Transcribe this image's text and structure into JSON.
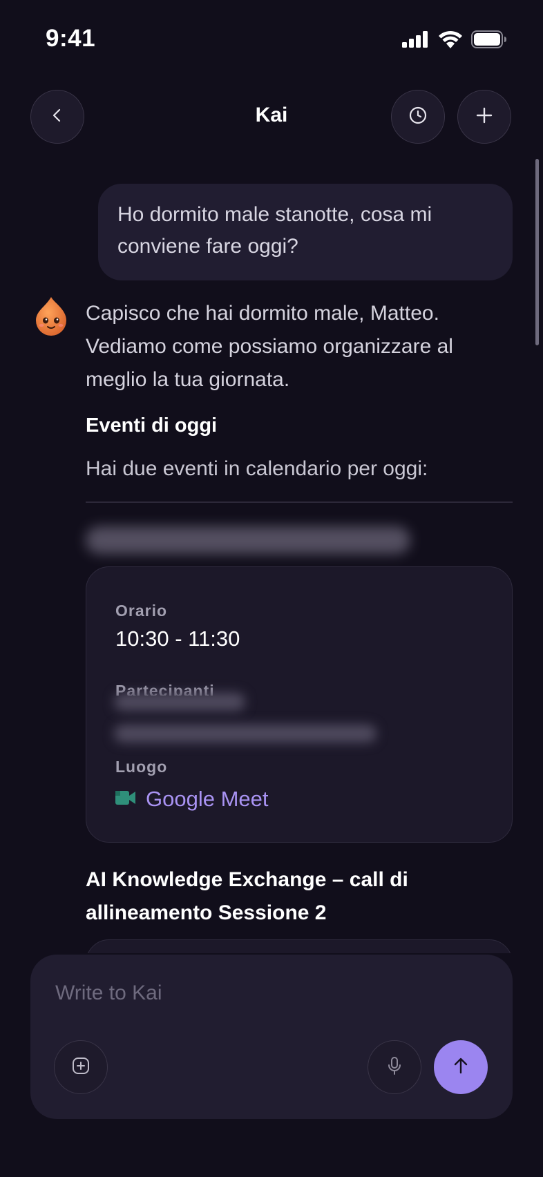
{
  "status_bar": {
    "time": "9:41",
    "icons": [
      "cellular-signal-icon",
      "wifi-icon",
      "battery-icon"
    ]
  },
  "header": {
    "title": "Kai",
    "back_icon": "chevron-left-icon",
    "history_icon": "clock-icon",
    "new_chat_icon": "plus-icon"
  },
  "messages": {
    "user": "Ho dormito male stanotte, cosa mi conviene fare oggi?",
    "assistant": {
      "avatar": "kai-mascot-icon",
      "intro": "Capisco che hai dormito male, Matteo. Vediamo come possiamo organizzare al meglio la tua giornata.",
      "section_title": "Eventi di oggi",
      "section_subtitle": "Hai due eventi in calendario per oggi:",
      "event1": {
        "time_label": "Orario",
        "time_value": "10:30 - 11:30",
        "participants_label": "Partecipanti",
        "location_label": "Luogo",
        "location_value": "Google Meet",
        "location_icon": "google-meet-icon"
      },
      "event2": {
        "title": "AI Knowledge Exchange – call di allineamento Sessione 2"
      }
    }
  },
  "composer": {
    "placeholder": "Write to Kai",
    "attach_icon": "plus-square-icon",
    "mic_icon": "microphone-icon",
    "send_icon": "arrow-up-icon"
  },
  "colors": {
    "background": "#110e1b",
    "accent": "#9b85f0",
    "link": "#a993f3"
  }
}
